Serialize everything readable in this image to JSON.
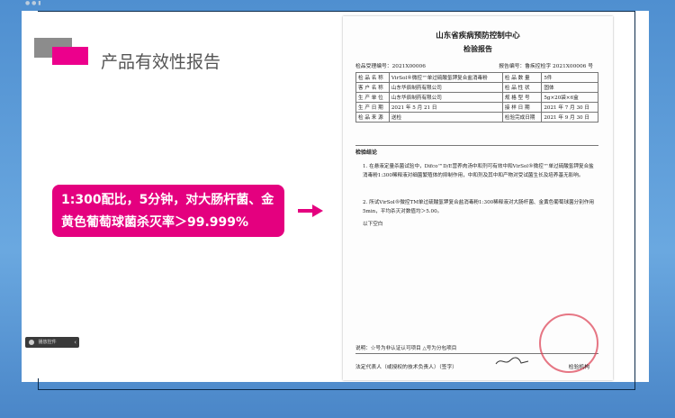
{
  "slide": {
    "title": "产品有效性报告",
    "callout_line1": "1:300配比，5分钟，对大肠杆菌、金",
    "callout_line2": "黄色葡萄球菌杀灭率＞99.999%",
    "colors": {
      "accent": "#ec008c",
      "callout_bg": "#e4007f",
      "block": "#8c8c8c"
    }
  },
  "document": {
    "org": "山东省疾病预防控制中心",
    "heading": "检验报告",
    "receipt_no": "检品受理编号：2021X00006",
    "report_no": "报告编号：鲁疾控检字 2021X00006 号",
    "rows": [
      [
        "检 品 名 称",
        "VirSol®微控™单过硫酸氢钾复合盐消毒粉",
        "检 品 数 量",
        "5件"
      ],
      [
        "客 户 名 称",
        "山东华辰制药有限公司",
        "检 品 性 状",
        "固体"
      ],
      [
        "生 产 单 位",
        "山东华辰制药有限公司",
        "规 格 型 号",
        "5g×20袋×6盒"
      ],
      [
        "生 产 日 期",
        "2021 年 5 月 21 日",
        "接 样 日 期",
        "2021 年 7 月 30 日"
      ],
      [
        "检 品 来 源",
        "送检",
        "检验完成日期",
        "2021 年 9 月 30 日"
      ]
    ],
    "conclusion_label": "检验结论",
    "item1": "1. 在悬液定量杀菌试验中，Difco™D/E营养肉汤中和剂可有效中和VirSol®微控™单过硫酸氢钾复合盐消毒粉1:300稀释液对细菌繁殖体的抑制作用，中和剂及其中和产物对受试菌生长及培养基无影响。",
    "item2": "2. 所试VirSol®微控TM单过硫酸氢钾复合盐消毒粉1:300稀释液对大肠杆菌、金黄色葡萄球菌分别作用5min，平均杀灭对数值均＞5.00。",
    "item3": "以下空白",
    "note": "说明：☆号为非认证认可项目 △号为分包项目",
    "signer": "法定代表人（或授权的技术负责人）（签字）",
    "stamp_label": "检验机构"
  },
  "player": {
    "label": "播放控件"
  }
}
